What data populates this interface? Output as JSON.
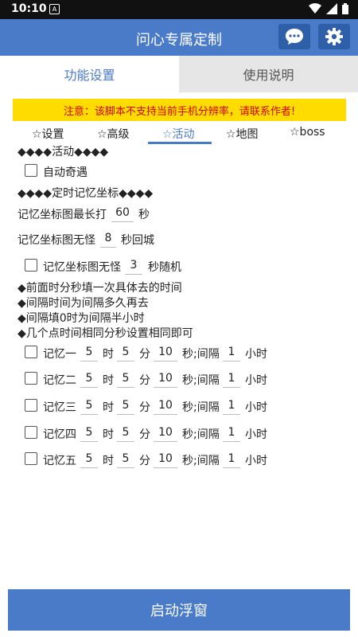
{
  "status_bar": {
    "time": "10:10",
    "app_badge": "A"
  },
  "app_bar": {
    "title": "问心专属定制"
  },
  "tabs": [
    {
      "label": "功能设置"
    },
    {
      "label": "使用说明"
    }
  ],
  "warning": "注意：该脚本不支持当前手机分辨率，请联系作者!",
  "subtabs": [
    "☆设置",
    "☆高级",
    "☆活动",
    "☆地图",
    "☆boss"
  ],
  "activity": {
    "section1_header": "◆◆◆◆活动◆◆◆◆",
    "auto_encounter_label": "自动奇遇",
    "section2_header": "◆◆◆◆定时记忆坐标◆◆◆◆",
    "max_hit": {
      "prefix": "记忆坐标图最长打",
      "value": "60",
      "suffix": "秒"
    },
    "no_monster_return": {
      "prefix": "记忆坐标图无怪",
      "value": "8",
      "suffix": "秒回城"
    },
    "no_monster_random": {
      "prefix": "记忆坐标图无怪",
      "value": "3",
      "suffix": "秒随机"
    },
    "notes": [
      "◆前面时分秒填一次具体去的时间",
      "◆间隔时间为间隔多久再去",
      "◆间隔填0时为间隔半小时",
      "◆几个点时间相同分秒设置相同即可"
    ],
    "units": {
      "hour": "时",
      "minute": "分",
      "second": "秒;间隔",
      "interval_unit": "小时"
    },
    "memories": [
      {
        "label": "记忆一",
        "hour": "5",
        "minute": "5",
        "second": "10",
        "interval": "1"
      },
      {
        "label": "记忆二",
        "hour": "5",
        "minute": "5",
        "second": "10",
        "interval": "1"
      },
      {
        "label": "记忆三",
        "hour": "5",
        "minute": "5",
        "second": "10",
        "interval": "1"
      },
      {
        "label": "记忆四",
        "hour": "5",
        "minute": "5",
        "second": "10",
        "interval": "1"
      },
      {
        "label": "记忆五",
        "hour": "5",
        "minute": "5",
        "second": "10",
        "interval": "1"
      }
    ]
  },
  "start_button": "启动浮窗"
}
